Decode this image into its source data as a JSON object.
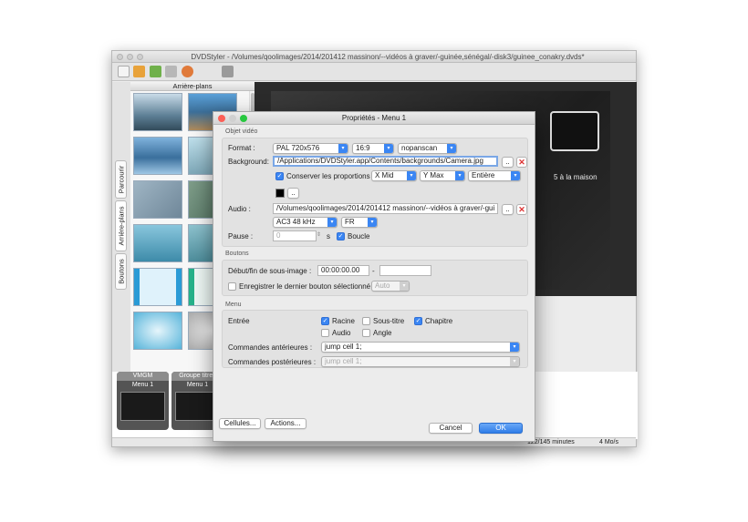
{
  "main_window": {
    "title": "DVDStyler - /Volumes/qoolimages/2014/201412 massinon/--vidéos à graver/-guinée,sénégal/-disk3/guinee_conakry.dvds*",
    "side_tabs": [
      "Parcourir",
      "Arrière-plans",
      "Boutons"
    ],
    "panel_title": "Arrière-plans",
    "preview_caption": "5 à la maison",
    "menus": [
      {
        "header": "VMGM",
        "label": "Menu 1"
      },
      {
        "header": "Groupe titres",
        "label": "Menu 1"
      }
    ],
    "status_duration": "122/145 minutes",
    "status_rate": "4 Mo/s"
  },
  "dialog": {
    "title": "Propriétés - Menu 1",
    "video_group_label": "Objet vidéo",
    "format_label": "Format :",
    "format_value": "PAL 720x576",
    "aspect_value": "16:9",
    "scan_value": "nopanscan",
    "background_label": "Background:",
    "background_value": "/Applications/DVDStyler.app/Contents/backgrounds/Camera.jpg",
    "browse_label": "..",
    "keep_ratio_label": "Conserver les proportions",
    "keep_ratio_checked": true,
    "x_align": "X Mid",
    "y_align": "Y Max",
    "fill_mode": "Entière",
    "bg_color": "#000000",
    "audio_label": "Audio :",
    "audio_value": "/Volumes/qoolimages/2014/201412 massinon/--vidéos à graver/-gui",
    "audio_codec": "AC3 48 kHz",
    "audio_lang": "FR",
    "pause_label": "Pause :",
    "pause_value": "0",
    "pause_unit": "s",
    "loop_label": "Boucle",
    "loop_checked": true,
    "buttons_group_label": "Boutons",
    "subimage_label": "Début/fin de sous-image :",
    "subimage_start": "00:00:00.00",
    "subimage_sep": "-",
    "subimage_end": "",
    "save_last_label": "Enregistrer le dernier bouton sélectionné",
    "save_last_checked": false,
    "save_last_mode": "Auto",
    "menu_group_label": "Menu",
    "entry_label": "Entrée",
    "entries": [
      {
        "label": "Racine",
        "checked": true
      },
      {
        "label": "Sous-titre",
        "checked": false
      },
      {
        "label": "Chapitre",
        "checked": true
      },
      {
        "label": "Audio",
        "checked": false
      },
      {
        "label": "Angle",
        "checked": false
      }
    ],
    "pre_commands_label": "Commandes antérieures :",
    "pre_commands_value": "jump cell 1;",
    "post_commands_label": "Commandes postérieures :",
    "post_commands_value": "jump cell 1;",
    "cells_button": "Cellules...",
    "actions_button": "Actions...",
    "cancel_button": "Cancel",
    "ok_button": "OK"
  },
  "colors": {
    "accent": "#3b86f3",
    "close": "#fc5f57",
    "minimize": "#fdbc2e",
    "zoom": "#28c840"
  }
}
